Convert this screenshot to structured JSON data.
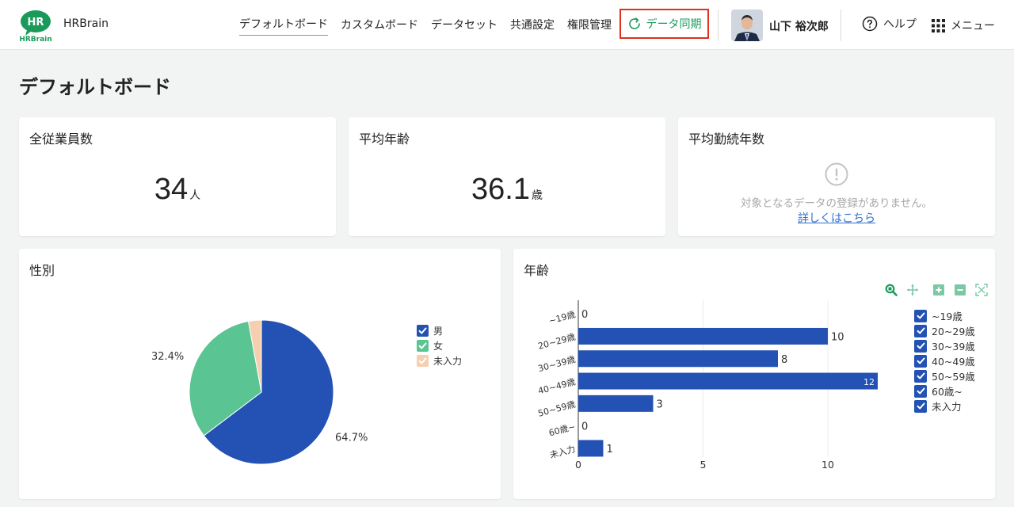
{
  "header": {
    "app_name": "HRBrain",
    "logo_text_top": "HR",
    "logo_text_bottom": "HRBrain",
    "nav": [
      {
        "label": "デフォルトボード",
        "active": true
      },
      {
        "label": "カスタムボード",
        "active": false
      },
      {
        "label": "データセット",
        "active": false
      },
      {
        "label": "共通設定",
        "active": false
      },
      {
        "label": "権限管理",
        "active": false
      }
    ],
    "sync_label": "データ同期",
    "user_name": "山下 裕次郎",
    "help_label": "ヘルプ",
    "menu_label": "メニュー"
  },
  "page": {
    "title": "デフォルトボード"
  },
  "cards": {
    "total_employees": {
      "title": "全従業員数",
      "value": "34",
      "unit": "人"
    },
    "average_age": {
      "title": "平均年齢",
      "value": "36.1",
      "unit": "歳"
    },
    "average_tenure": {
      "title": "平均勤続年数",
      "message": "対象となるデータの登録がありません。",
      "link": "詳しくはこちら"
    },
    "gender": {
      "title": "性別"
    },
    "age": {
      "title": "年齢"
    }
  },
  "colors": {
    "accent_green": "#1a9a5a",
    "highlight_red": "#e0301e",
    "bar_blue": "#2352b4",
    "pie_male": "#2352b4",
    "pie_female": "#5ac492",
    "pie_unset": "#f6cfb0",
    "check_blue": "#2352b4",
    "check_green": "#5ac492",
    "check_peach": "#f6cfb0"
  },
  "chart_data": [
    {
      "type": "pie",
      "labels": [
        "男",
        "女",
        "未入力"
      ],
      "percent": [
        64.7,
        32.4,
        2.9
      ],
      "data_labels": [
        "64.7%",
        "32.4%",
        ""
      ],
      "legend": [
        "男",
        "女",
        "未入力"
      ],
      "legend_position": "right"
    },
    {
      "type": "bar",
      "orientation": "horizontal",
      "categories": [
        "~19歳",
        "20~29歳",
        "30~39歳",
        "40~49歳",
        "50~59歳",
        "60歳~",
        "未入力"
      ],
      "values": [
        0,
        10,
        8,
        12,
        3,
        0,
        1
      ],
      "x_ticks": [
        0,
        5,
        10
      ],
      "xlim": [
        0,
        12
      ],
      "grid": "vertical",
      "legend": [
        "~19歳",
        "20~29歳",
        "30~39歳",
        "40~49歳",
        "50~59歳",
        "60歳~",
        "未入力"
      ],
      "legend_position": "right"
    }
  ]
}
